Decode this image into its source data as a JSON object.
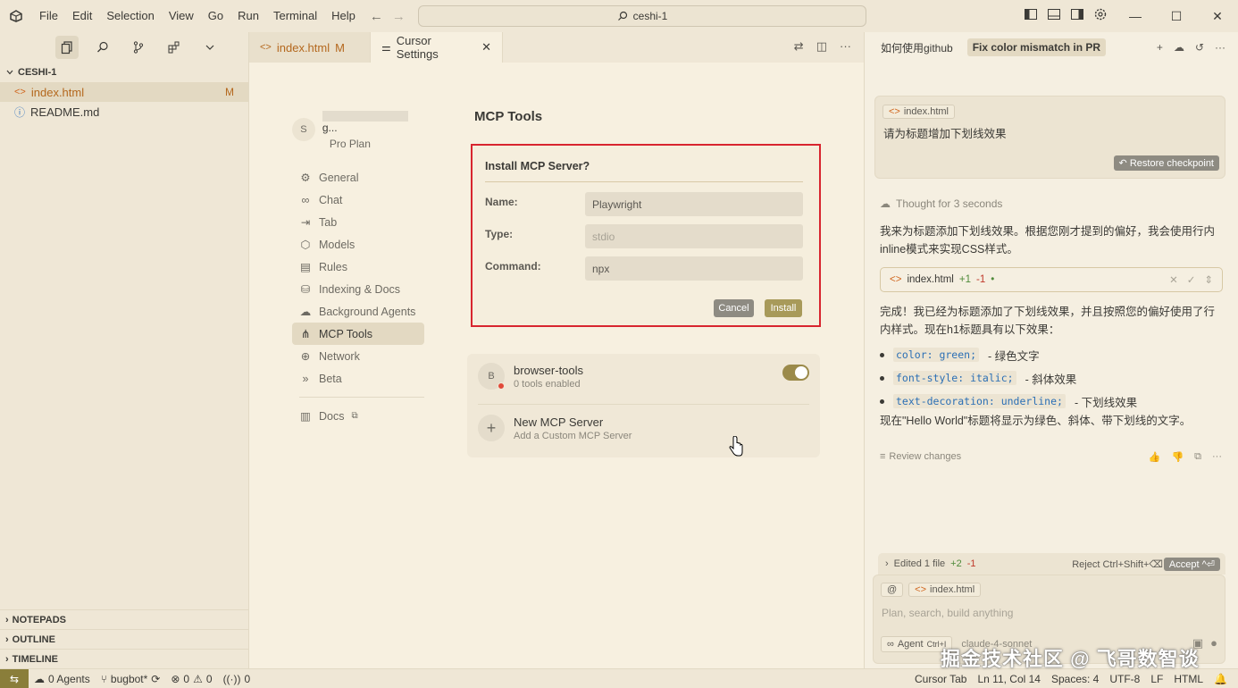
{
  "titlebar": {
    "menu": [
      "File",
      "Edit",
      "Selection",
      "View",
      "Go",
      "Run",
      "Terminal",
      "Help"
    ],
    "search": "ceshi-1"
  },
  "explorer": {
    "folder": "CESHI-1",
    "files": [
      {
        "name": "index.html",
        "badge": "M"
      },
      {
        "name": "README.md",
        "badge": ""
      }
    ],
    "bottom_sections": [
      "NOTEPADS",
      "OUTLINE",
      "TIMELINE"
    ]
  },
  "editor": {
    "tabs": [
      {
        "label": "index.html",
        "badge": "M"
      },
      {
        "label": "Cursor Settings"
      }
    ],
    "user": {
      "initial": "S",
      "suffix": "g...",
      "plan": "Pro Plan"
    },
    "nav": [
      "General",
      "Chat",
      "Tab",
      "Models",
      "Rules",
      "Indexing & Docs",
      "Background Agents",
      "MCP Tools",
      "Network",
      "Beta"
    ],
    "docs": "Docs",
    "page_title": "MCP Tools",
    "install": {
      "title": "Install MCP Server?",
      "name_label": "Name:",
      "name_value": "Playwright",
      "type_label": "Type:",
      "type_value": "stdio",
      "command_label": "Command:",
      "command_value": "npx",
      "cancel": "Cancel",
      "install": "Install"
    },
    "servers": [
      {
        "initial": "B",
        "name": "browser-tools",
        "sub": "0 tools enabled"
      },
      {
        "name": "New MCP Server",
        "sub": "Add a Custom MCP Server"
      }
    ]
  },
  "chat": {
    "tabs": [
      "如何使用github",
      "Fix color mismatch in PR"
    ],
    "user_msg": {
      "chip": "index.html",
      "text": "请为标题增加下划线效果",
      "restore": "Restore checkpoint"
    },
    "thought": "Thought for 3 seconds",
    "reply1": "我来为标题添加下划线效果。根据您刚才提到的偏好，我会使用行内inline模式来实现CSS样式。",
    "file_chip": {
      "name": "index.html",
      "diff_add": "+1",
      "diff_del": "-1"
    },
    "reply2": "完成！我已经为标题添加了下划线效果，并且按照您的偏好使用了行内样式。现在h1标题具有以下效果：",
    "bullets": [
      {
        "code": "color: green;",
        "text": "- 绿色文字"
      },
      {
        "code": "font-style: italic;",
        "text": "- 斜体效果"
      },
      {
        "code": "text-decoration: underline;",
        "text": "- 下划线效果"
      }
    ],
    "reply3": "现在\"Hello World\"标题将显示为绿色、斜体、带下划线的文字。",
    "review": "Review changes",
    "edited": {
      "text": "Edited 1 file",
      "add": "+2",
      "del": "-1",
      "reject": "Reject Ctrl+Shift+⌫",
      "accept": "Accept ^⏎"
    },
    "input": {
      "chip": "index.html",
      "placeholder": "Plan, search, build anything",
      "agent": "Agent",
      "agent_shortcut": "Ctrl+I",
      "model": "claude-4-sonnet"
    }
  },
  "status": {
    "agents": "0 Agents",
    "branch": "bugbot*",
    "errors": "0",
    "warnings": "0",
    "ports": "0",
    "right": [
      "Cursor Tab",
      "Ln 11, Col 14",
      "Spaces: 4",
      "UTF-8",
      "LF",
      "HTML"
    ]
  },
  "watermark": "掘金技术社区 @ 飞哥数智谈",
  "colors": {
    "accent": "#9b8a4a",
    "highlight_border": "#d8252f",
    "modified": "#b4681e"
  }
}
